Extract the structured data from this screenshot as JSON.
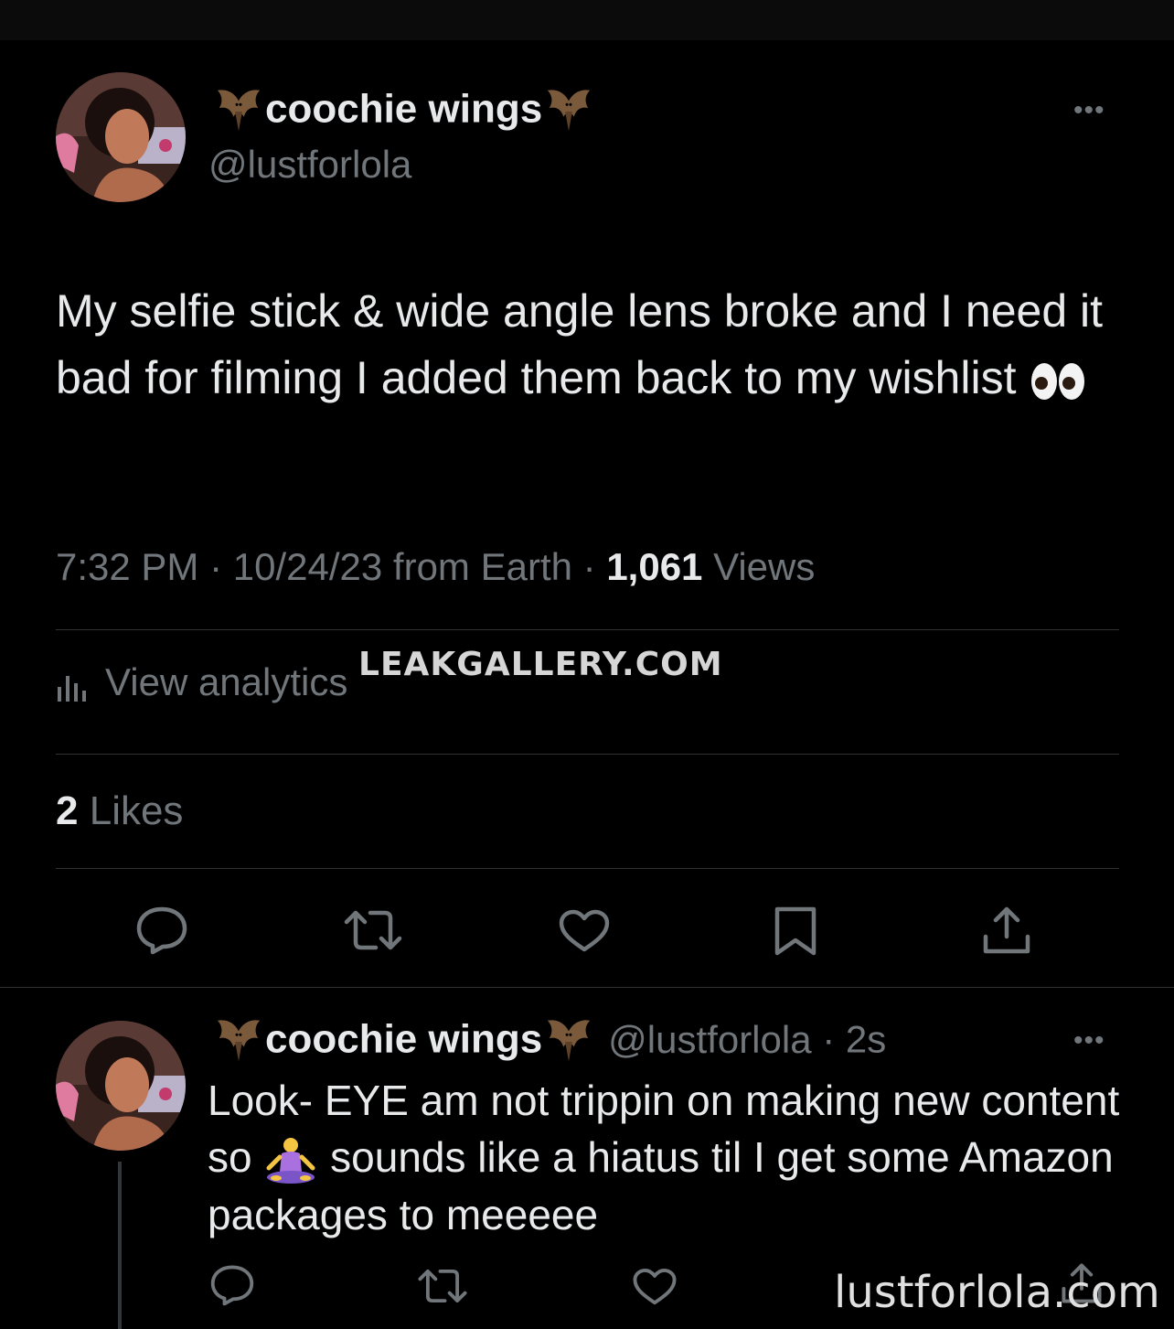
{
  "tweet": {
    "display_name": "coochie wings",
    "handle": "@lustforlola",
    "text": "My selfie stick & wide angle lens broke and I need it bad for filming I added them back to my wishlist",
    "emoji_name": "eyes-emoji",
    "time": "7:32 PM",
    "separator": " · ",
    "date": "10/24/23",
    "source": "from Earth",
    "views_count": "1,061",
    "views_label": "Views",
    "analytics_label": "View analytics",
    "likes_count": "2",
    "likes_label": "Likes",
    "more_label": "•••",
    "actions": [
      "reply-icon",
      "retweet-icon",
      "like-icon",
      "bookmark-icon",
      "share-icon"
    ]
  },
  "reply": {
    "display_name": "coochie wings",
    "handle": "@lustforlola",
    "separator": " · ",
    "time_ago": "2s",
    "text_before": "Look- EYE am not trippin on making new content so ",
    "emoji_name": "person-in-lotus-position-emoji",
    "text_after": " sounds like a hiatus til I get some Amazon packages to meeeee",
    "more_label": "•••",
    "actions": [
      "reply-icon",
      "retweet-icon",
      "like-icon",
      "share-icon"
    ]
  },
  "watermarks": {
    "center": "LEAKGALLERY.COM",
    "corner": "lustforlola.com"
  },
  "colors": {
    "background": "#000000",
    "text": "#e7e9ea",
    "secondary": "#71767b",
    "divider": "#2f3336"
  }
}
